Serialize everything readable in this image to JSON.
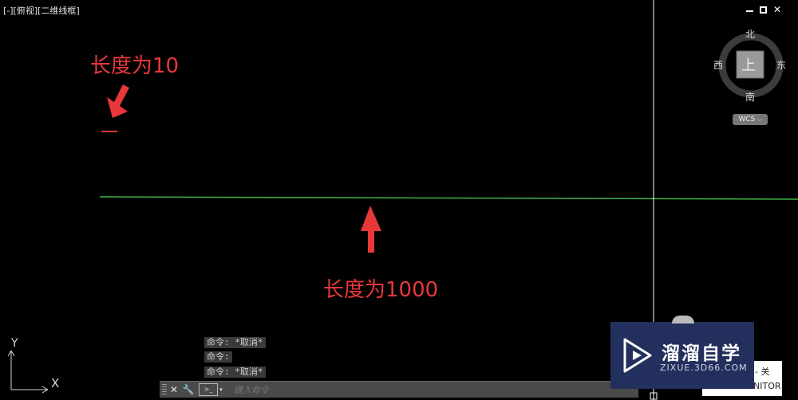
{
  "viewport": {
    "label": "[-][俯视][二维线框]"
  },
  "window_controls": {
    "minimize_icon": "minimize-icon",
    "restore_icon": "restore-icon",
    "close_icon": "close-icon"
  },
  "annotations": {
    "short_line": "长度为10",
    "long_line": "长度为1000"
  },
  "colors": {
    "annotation": "#e8383a",
    "long_line": "#3fb544",
    "short_line": "#d63636",
    "crosshair": "#ffffff"
  },
  "viewcube": {
    "north": "北",
    "south": "南",
    "east": "东",
    "west": "西",
    "face": "上",
    "wcs_label": "WCS"
  },
  "ucs_icon": {
    "x_label": "X",
    "y_label": "Y"
  },
  "command_line": {
    "history": [
      "命令: *取消*",
      "命令:",
      "命令: *取消*"
    ],
    "placeholder": "键入命令",
    "close_icon": "close-icon",
    "customize_icon": "wrench-icon"
  },
  "watermark": {
    "name": "溜溜自学",
    "url": "ZIXUE.3D66.COM"
  },
  "tooltip": {
    "line1": "- 关",
    "line2": "NITOR"
  }
}
